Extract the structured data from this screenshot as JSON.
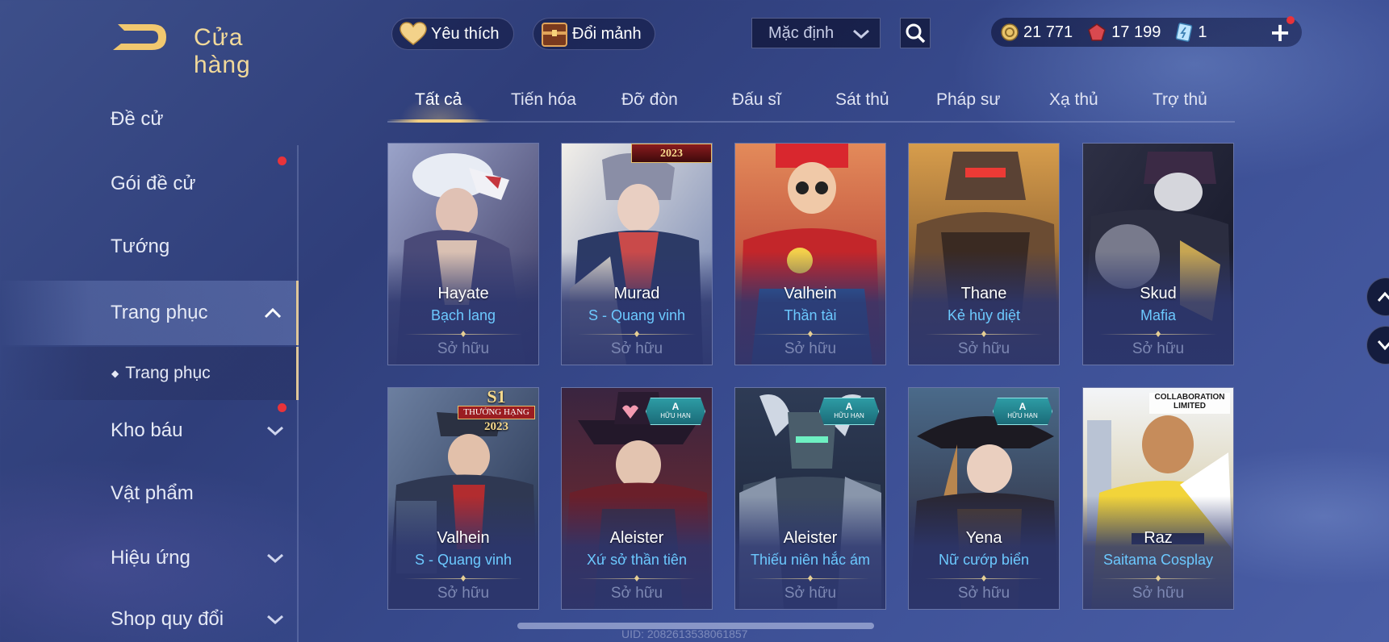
{
  "header": {
    "title": "Cửa hàng",
    "favorite_label": "Yêu thích",
    "exchange_label": "Đổi mảnh",
    "sort_dropdown": "Mặc định"
  },
  "currency": {
    "gold": "21 771",
    "ruby": "17 199",
    "coupon": "1"
  },
  "sidebar": {
    "items": [
      {
        "label": "Đề cử"
      },
      {
        "label": "Gói đề cử"
      },
      {
        "label": "Tướng"
      },
      {
        "label": "Trang phục"
      },
      {
        "label": "Trang phục"
      },
      {
        "label": "Kho báu"
      },
      {
        "label": "Vật phẩm"
      },
      {
        "label": "Hiệu ứng"
      },
      {
        "label": "Shop quy đổi"
      }
    ]
  },
  "tabs": [
    {
      "label": "Tất cả"
    },
    {
      "label": "Tiến hóa"
    },
    {
      "label": "Đỡ đòn"
    },
    {
      "label": "Đấu sĩ"
    },
    {
      "label": "Sát thủ"
    },
    {
      "label": "Pháp sư"
    },
    {
      "label": "Xạ thủ"
    },
    {
      "label": "Trợ thủ"
    }
  ],
  "skins": [
    {
      "hero": "Hayate",
      "skin": "Bạch lang",
      "status": "Sở hữu"
    },
    {
      "hero": "Murad",
      "skin": "S - Quang vinh",
      "status": "Sở hữu",
      "badge_text": "2023"
    },
    {
      "hero": "Valhein",
      "skin": "Thần tài",
      "status": "Sở hữu"
    },
    {
      "hero": "Thane",
      "skin": "Kẻ hủy diệt",
      "status": "Sở hữu"
    },
    {
      "hero": "Skud",
      "skin": "Mafia",
      "status": "Sở hữu"
    },
    {
      "hero": "Valhein",
      "skin": "S - Quang vinh",
      "status": "Sở hữu",
      "badge_s1": "S1",
      "badge_rank": "THƯỞNG HẠNG",
      "badge_year": "2023"
    },
    {
      "hero": "Aleister",
      "skin": "Xứ sở thần tiên",
      "status": "Sở hữu",
      "badge_a": "A",
      "badge_sub": "HỮU HẠN"
    },
    {
      "hero": "Aleister",
      "skin": "Thiếu niên hắc ám",
      "status": "Sở hữu",
      "badge_a": "A",
      "badge_sub": "HỮU HẠN"
    },
    {
      "hero": "Yena",
      "skin": "Nữ cướp biển",
      "status": "Sở hữu",
      "badge_a": "A",
      "badge_sub": "HỮU HẠN"
    },
    {
      "hero": "Raz",
      "skin": "Saitama Cosplay",
      "status": "Sở hữu",
      "badge_collab": "COLLABORATION LIMITED"
    }
  ],
  "footer": {
    "uid": "UID: 2082613538061857"
  },
  "colors": {
    "accent_gold": "#f1d99a",
    "skin_blue": "#6cc9ff",
    "red_dot": "#e8333a"
  }
}
